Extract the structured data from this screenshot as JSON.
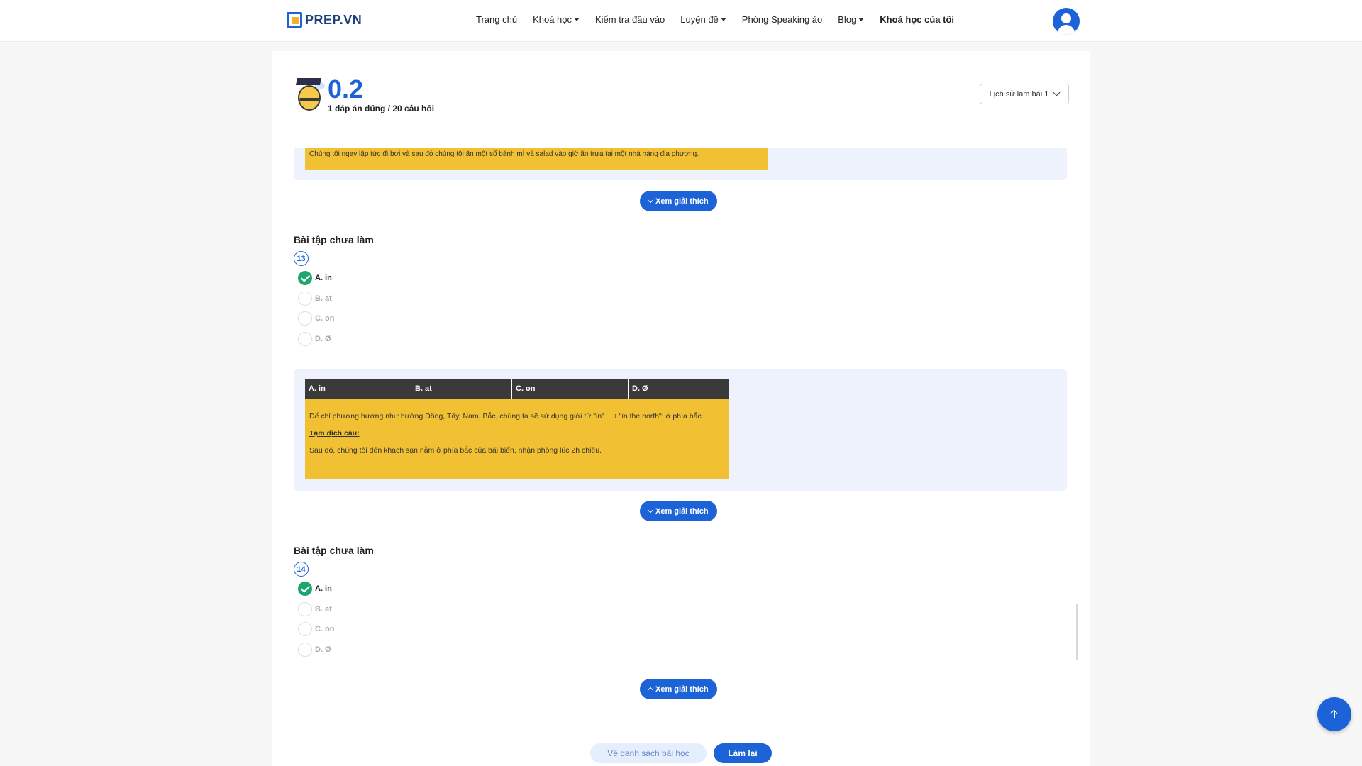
{
  "nav": {
    "logo": "PREP.VN",
    "items": [
      {
        "label": "Trang chủ",
        "caret": false,
        "bold": false
      },
      {
        "label": "Khoá học",
        "caret": true,
        "bold": false
      },
      {
        "label": "Kiểm tra đầu vào",
        "caret": false,
        "bold": false
      },
      {
        "label": "Luyện đề",
        "caret": true,
        "bold": false
      },
      {
        "label": "Phòng Speaking ảo",
        "caret": false,
        "bold": false
      },
      {
        "label": "Blog",
        "caret": true,
        "bold": false
      },
      {
        "label": "Khoá học của tôi",
        "caret": false,
        "bold": true
      }
    ]
  },
  "score": {
    "value": "0.2",
    "summary": "1 đáp án đúng / 20 câu hỏi"
  },
  "history": {
    "label": "Lịch sử làm bài 1"
  },
  "prev_explain": {
    "translation": "Chúng tôi ngay lập tức đi bơi và sau đó chúng tôi ăn một số bánh mì và salad vào giờ ăn trưa tại một nhà hàng địa phương."
  },
  "explain_button": "Xem giải thích",
  "questions": [
    {
      "heading": "Bài tập chưa làm",
      "number": "13",
      "options": [
        {
          "label": "A. in",
          "correct": true
        },
        {
          "label": "B. at",
          "correct": false
        },
        {
          "label": "C. on",
          "correct": false
        },
        {
          "label": "D. Ø",
          "correct": false
        }
      ]
    },
    {
      "heading": "Bài tập chưa làm",
      "number": "14",
      "options": [
        {
          "label": "A. in",
          "correct": true
        },
        {
          "label": "B. at",
          "correct": false
        },
        {
          "label": "C. on",
          "correct": false
        },
        {
          "label": "D. Ø",
          "correct": false
        }
      ]
    }
  ],
  "explain13": {
    "columns": [
      "A. in",
      "B. at",
      "C. on",
      "D. Ø"
    ],
    "rule": "Để chỉ phương hướng như hướng Đông, Tây, Nam, Bắc, chúng ta sẽ sử dụng giới từ \"in\" ⟶ \"in the north\": ở phía bắc.",
    "translate_label": "Tạm dịch câu:",
    "translation": "Sau đó, chúng tôi đến khách sạn nằm ở phía bắc của bãi biển, nhận phòng lúc 2h chiều."
  },
  "footer": {
    "back": "Về danh sách bài học",
    "retry": "Làm lại"
  },
  "colors": {
    "primary": "#1d63d8",
    "highlight": "#f2c033",
    "panel_tint": "#edf2fc",
    "correct": "#1fa56e"
  }
}
